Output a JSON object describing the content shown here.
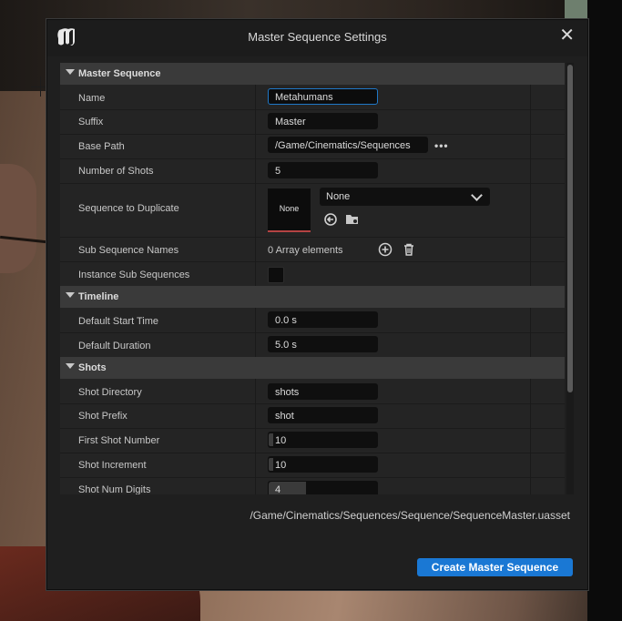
{
  "window": {
    "title": "Master Sequence Settings",
    "close_icon": "close-icon"
  },
  "sections": {
    "master": {
      "label": "Master Sequence"
    },
    "timeline": {
      "label": "Timeline"
    },
    "shots": {
      "label": "Shots"
    }
  },
  "fields": {
    "name": {
      "label": "Name",
      "value": "Metahumans"
    },
    "suffix": {
      "label": "Suffix",
      "value": "Master"
    },
    "base_path": {
      "label": "Base Path",
      "value": "/Game/Cinematics/Sequences",
      "browse": "•••"
    },
    "number_of_shots": {
      "label": "Number of Shots",
      "value": "5"
    },
    "sequence_to_duplicate": {
      "label": "Sequence to Duplicate",
      "thumbnail_text": "None",
      "selected": "None"
    },
    "sub_sequence_names": {
      "label": "Sub Sequence Names",
      "value": "0 Array elements"
    },
    "instance_sub_sequences": {
      "label": "Instance Sub Sequences",
      "checked": false
    },
    "default_start_time": {
      "label": "Default Start Time",
      "value": "0.0 s"
    },
    "default_duration": {
      "label": "Default Duration",
      "value": "5.0 s"
    },
    "shot_directory": {
      "label": "Shot Directory",
      "value": "shots"
    },
    "shot_prefix": {
      "label": "Shot Prefix",
      "value": "shot"
    },
    "first_shot_number": {
      "label": "First Shot Number",
      "value": "10"
    },
    "shot_increment": {
      "label": "Shot Increment",
      "value": "10"
    },
    "shot_num_digits": {
      "label": "Shot Num Digits",
      "value": "4"
    }
  },
  "footer": {
    "asset_path": "/Game/Cinematics/Sequences/Sequence/SequenceMaster.uasset",
    "create_label": "Create Master Sequence"
  },
  "colors": {
    "accent": "#1a78d4",
    "dialog_bg": "#1f1f1f",
    "section_bg": "#3a3a3a"
  }
}
